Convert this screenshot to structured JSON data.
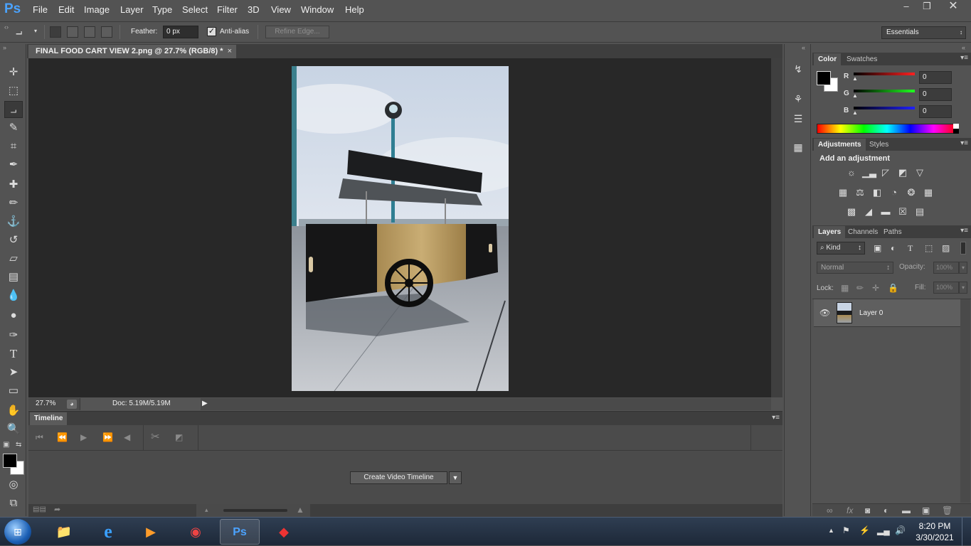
{
  "app": {
    "logo": "Ps",
    "menu": [
      "File",
      "Edit",
      "Image",
      "Layer",
      "Type",
      "Select",
      "Filter",
      "3D",
      "View",
      "Window",
      "Help"
    ],
    "window_controls": [
      "minimize",
      "restore",
      "close"
    ]
  },
  "options_bar": {
    "feather_label": "Feather:",
    "feather_value": "0 px",
    "antialias_label": "Anti-alias",
    "antialias_checked": true,
    "refine_edge_label": "Refine Edge...",
    "workspace": "Essentials"
  },
  "toolbar": {
    "tools": [
      "move-tool",
      "marquee-tool",
      "polygonal-lasso-tool",
      "quick-selection-tool",
      "crop-tool",
      "eyedropper-tool",
      "healing-brush-tool",
      "brush-tool",
      "clone-stamp-tool",
      "history-brush-tool",
      "eraser-tool",
      "gradient-tool",
      "blur-tool",
      "dodge-tool",
      "pen-tool",
      "type-tool",
      "path-selection-tool",
      "rectangle-tool",
      "hand-tool",
      "zoom-tool"
    ],
    "active_tool": "polygonal-lasso-tool",
    "foreground_color": "#000000",
    "background_color": "#ffffff"
  },
  "document": {
    "tab_title": "FINAL FOOD CART VIEW 2.png @ 27.7% (RGB/8) *",
    "zoom": "27.7%",
    "doc_size": "Doc: 5.19M/5.19M"
  },
  "timeline": {
    "tab_label": "Timeline",
    "create_button": "Create Video Timeline"
  },
  "color_panel": {
    "tabs": [
      "Color",
      "Swatches"
    ],
    "active_tab": "Color",
    "channels": [
      {
        "label": "R",
        "value": "0",
        "color": "#ff2020"
      },
      {
        "label": "G",
        "value": "0",
        "color": "#20ff20"
      },
      {
        "label": "B",
        "value": "0",
        "color": "#2020ff"
      }
    ]
  },
  "adjustments_panel": {
    "tabs": [
      "Adjustments",
      "Styles"
    ],
    "active_tab": "Adjustments",
    "heading": "Add an adjustment"
  },
  "layers_panel": {
    "tabs": [
      "Layers",
      "Channels",
      "Paths"
    ],
    "active_tab": "Layers",
    "filter_kind": "Kind",
    "blend_mode": "Normal",
    "opacity_label": "Opacity:",
    "opacity_value": "100%",
    "lock_label": "Lock:",
    "fill_label": "Fill:",
    "fill_value": "100%",
    "layers": [
      {
        "name": "Layer 0",
        "visible": true
      }
    ]
  },
  "taskbar": {
    "apps": [
      "windows-explorer",
      "internet-explorer",
      "media-player",
      "chrome",
      "photoshop",
      "sketchup"
    ],
    "active_app": "photoshop",
    "time": "8:20 PM",
    "date": "3/30/2021"
  }
}
